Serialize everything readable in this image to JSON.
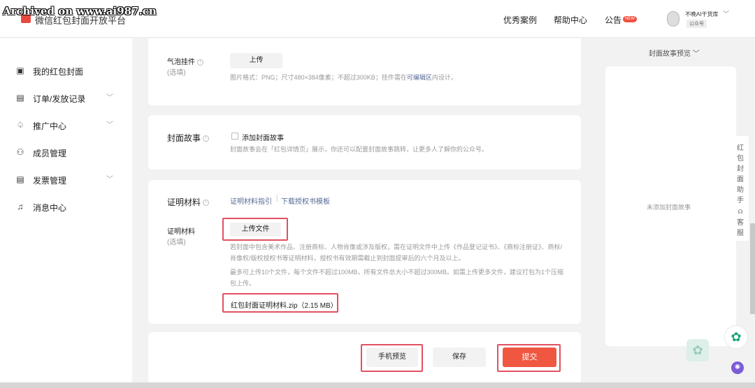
{
  "watermark": "Archived on www.ai987.cn",
  "brand": "微信红包封面开放平台",
  "nav": {
    "cases": "优秀案例",
    "help": "帮助中心",
    "notice": "公告",
    "badge": "NEW"
  },
  "account": {
    "name": "不晚AI干货库",
    "type": "公众号"
  },
  "sidebar": {
    "items": [
      {
        "label": "我的红包封面",
        "icon": "cover-icon"
      },
      {
        "label": "订单/发放记录",
        "icon": "order-icon",
        "chevron": "﹀"
      },
      {
        "label": "推广中心",
        "icon": "promote-icon",
        "chevron": "﹀"
      },
      {
        "label": "成员管理",
        "icon": "members-icon"
      },
      {
        "label": "发票管理",
        "icon": "invoice-icon",
        "chevron": "﹀"
      },
      {
        "label": "消息中心",
        "icon": "bell-icon"
      }
    ]
  },
  "bubble": {
    "label": "气泡挂件",
    "optional": "(选填)",
    "upload": "上传",
    "hint_pre": "图片格式：PNG；尺寸480×384像素；不超过300KB；挂件需在",
    "hint_link": "可编辑区",
    "hint_post": "内设计。"
  },
  "story": {
    "label": "封面故事",
    "checkbox_label": "添加封面故事",
    "hint": "封面故事会在「红包详情页」展示，你还可以配置封面故事跳转，让更多人了解你的公众号。"
  },
  "proof": {
    "label": "证明材料",
    "guide_link": "证明材料指引",
    "template_link": "下载授权书模板",
    "field_label": "证明材料",
    "optional": "(选填)",
    "upload_button": "上传文件",
    "hint1": "若封面中包含美术作品、注册商标、人物肖像或涉及版权，需在证明文件中上传《作品登记证书》、《商标注册证》、商标/肖像权/版权授权书等证明材料，授权书有效期需截止到封面提审后的六个月及以上。",
    "hint2": "最多可上传10个文件，每个文件不超过100MB，所有文件总大小不超过300MB。如需上传更多文件，建议打包为1个压缩包上传。",
    "file": "红包封面证明材料.zip（2.15 MB）"
  },
  "actions": {
    "preview": "手机预览",
    "save": "保存",
    "submit": "提交"
  },
  "preview_panel": {
    "title": "封面故事预览",
    "empty": "未添加封面故事"
  },
  "helpers": {
    "assistant": [
      "红",
      "包",
      "封",
      "面",
      "助",
      "手"
    ],
    "service": [
      "客",
      "服"
    ]
  },
  "colors": {
    "accent": "#ef5741",
    "link": "#576b95",
    "highlight": "#e25060"
  }
}
